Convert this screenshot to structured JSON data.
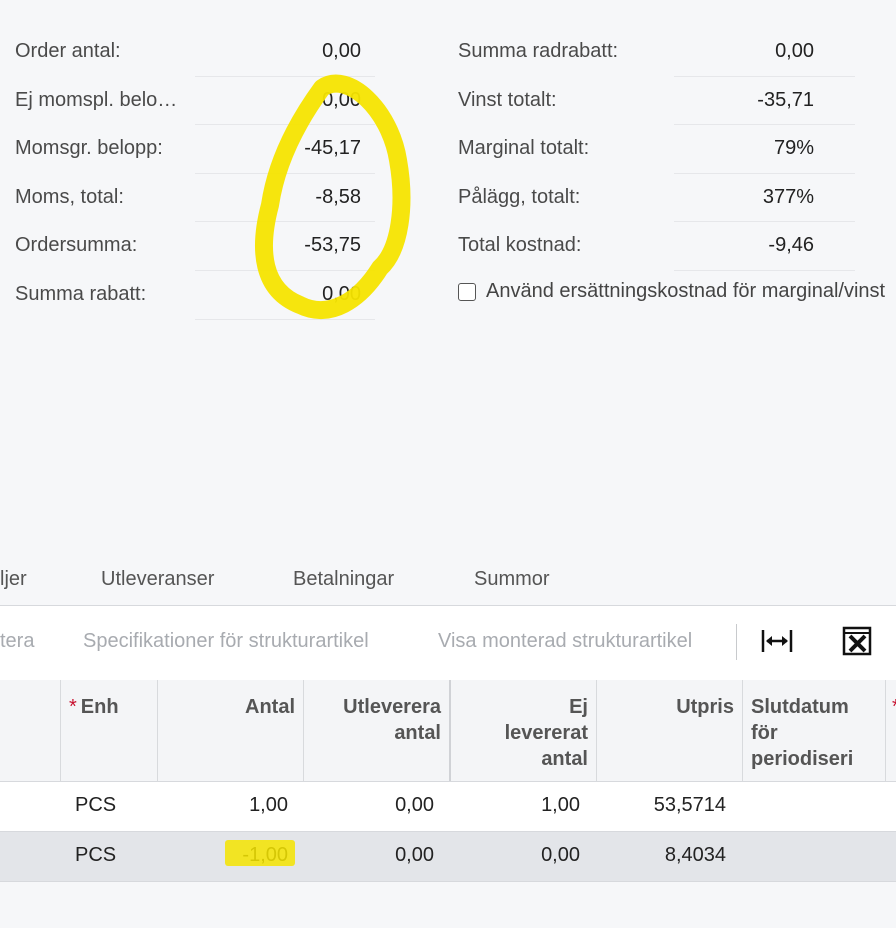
{
  "summary_left": [
    {
      "label": "Order antal:",
      "value": "0,00"
    },
    {
      "label": "Ej momspl. belo…",
      "value": "0,00"
    },
    {
      "label": "Momsgr. belopp:",
      "value": "-45,17"
    },
    {
      "label": "Moms, total:",
      "value": "-8,58"
    },
    {
      "label": "Ordersumma:",
      "value": "-53,75"
    },
    {
      "label": "Summa rabatt:",
      "value": "0,00"
    }
  ],
  "summary_right": [
    {
      "label": "Summa radrabatt:",
      "value": "0,00"
    },
    {
      "label": "Vinst totalt:",
      "value": "-35,71"
    },
    {
      "label": "Marginal totalt:",
      "value": "79%"
    },
    {
      "label": "Pålägg, totalt:",
      "value": "377%"
    },
    {
      "label": "Total kostnad:",
      "value": "-9,46"
    }
  ],
  "checkbox": {
    "label": "Använd ersättningskostnad för marginal/vinst",
    "checked": false
  },
  "tabs": [
    "ljer",
    "Utleveranser",
    "Betalningar",
    "Summor"
  ],
  "toolbar": {
    "buttons": [
      "tera",
      "Specifikationer för strukturartikel",
      "Visa monterad strukturartikel"
    ],
    "icons": [
      "fit-columns-icon",
      "excel-export-icon"
    ]
  },
  "grid": {
    "headers": [
      {
        "label": "Enh",
        "required": true
      },
      {
        "label": "Antal",
        "required": false
      },
      {
        "label": "Utleverera\nantal",
        "required": false
      },
      {
        "label": "Ej\nlevererat\nantal",
        "required": false
      },
      {
        "label": "Utpris",
        "required": false
      },
      {
        "label": "Slutdatum\nför\nperiodiseri",
        "required": false
      },
      {
        "label": "",
        "required": true
      }
    ],
    "rows": [
      {
        "unit": "PCS",
        "qty": "1,00",
        "delivered": "0,00",
        "not_delivered": "1,00",
        "price": "53,5714",
        "selected": false
      },
      {
        "unit": "PCS",
        "qty": "-1,00",
        "delivered": "0,00",
        "not_delivered": "0,00",
        "price": "8,4034",
        "selected": true
      }
    ]
  },
  "colors": {
    "highlight": "#f5e400",
    "required": "#c8102e"
  }
}
